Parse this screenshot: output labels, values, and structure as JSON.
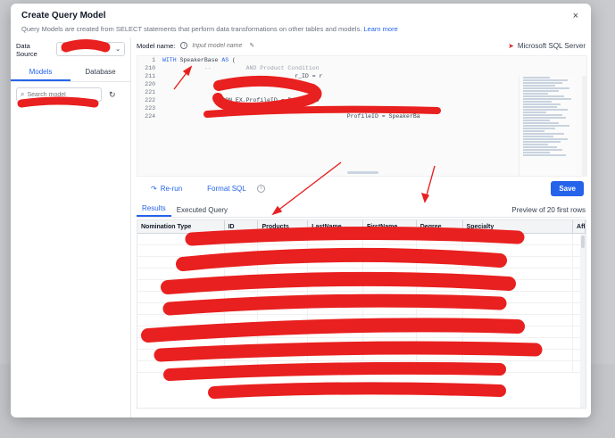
{
  "modal": {
    "title": "Create Query Model",
    "subtitle": "Query Models are created from SELECT statements that perform data transformations on other tables and models.",
    "learn_more": "Learn more",
    "close": "×"
  },
  "left_panel": {
    "data_source_label": "Data Source",
    "data_source_value": "",
    "tabs": [
      {
        "label": "Models",
        "active": true
      },
      {
        "label": "Database",
        "active": false
      }
    ],
    "search_placeholder": "Search model"
  },
  "model_bar": {
    "label": "Model name:",
    "input_placeholder": "Input model name",
    "server": "Microsoft SQL Server"
  },
  "editor": {
    "lines": [
      {
        "n": "1",
        "kw": "WITH",
        "text": " SpeakerBase ",
        "kw2": "AS",
        "rest": " ("
      },
      {
        "n": "210",
        "kw": "",
        "text": "            --          AND Product Condition",
        "kw2": "",
        "rest": ""
      },
      {
        "n": "211",
        "kw": "",
        "text": "                                      r_ID = r",
        "kw2": "",
        "rest": ""
      },
      {
        "n": "220",
        "kw": "",
        "text": "                ORDER BY SP",
        "kw2": "",
        "rest": ""
      },
      {
        "n": "221",
        "kw": "",
        "text": "",
        "kw2": "",
        "rest": ""
      },
      {
        "n": "222",
        "kw": "",
        "text": "                  ON EX.ProfileID = ",
        "kw2": "",
        "rest": "ProfileID"
      },
      {
        "n": "223",
        "kw": "",
        "text": "",
        "kw2": "",
        "rest": ""
      },
      {
        "n": "224",
        "kw": "",
        "text": "                                                     ProfileID = SpeakerBa",
        "kw2": "",
        "rest": ""
      }
    ]
  },
  "toolbar": {
    "rerun": "Re-run",
    "format": "Format SQL",
    "save": "Save"
  },
  "results": {
    "tabs": [
      {
        "label": "Results",
        "active": true
      },
      {
        "label": "Executed Query",
        "active": false
      }
    ],
    "preview": "Preview of 20 first rows",
    "columns": [
      "Nomination Type",
      "ID",
      "Products",
      "LastName",
      "FirstName",
      "Degree",
      "Specialty",
      "Affiliati"
    ],
    "row_count": 12
  },
  "colors": {
    "accent": "#2563eb",
    "annotation": "#e8201f"
  }
}
